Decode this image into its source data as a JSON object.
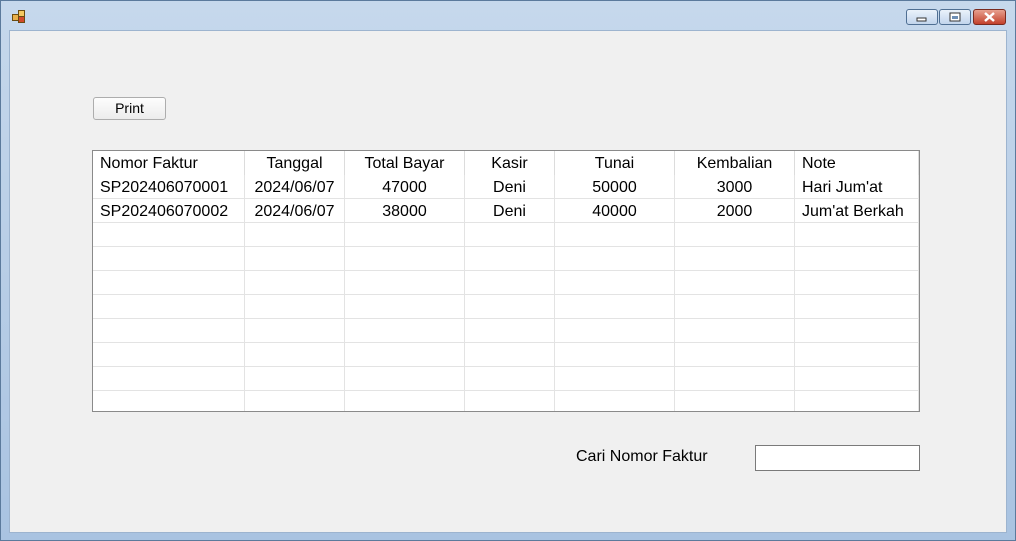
{
  "window": {
    "controls": [
      {
        "name": "minimize-icon"
      },
      {
        "name": "maximize-icon"
      },
      {
        "name": "close-icon"
      }
    ]
  },
  "toolbar": {
    "print_label": "Print"
  },
  "grid": {
    "columns": [
      "Nomor Faktur",
      "Tanggal",
      "Total Bayar",
      "Kasir",
      "Tunai",
      "Kembalian",
      "Note"
    ],
    "rows": [
      [
        "SP202406070001",
        "2024/06/07",
        "47000",
        "Deni",
        "50000",
        "3000",
        "Hari Jum'at"
      ],
      [
        "SP202406070002",
        "2024/06/07",
        "38000",
        "Deni",
        "40000",
        "2000",
        "Jum'at Berkah"
      ]
    ]
  },
  "search": {
    "label": "Cari Nomor Faktur",
    "value": ""
  }
}
